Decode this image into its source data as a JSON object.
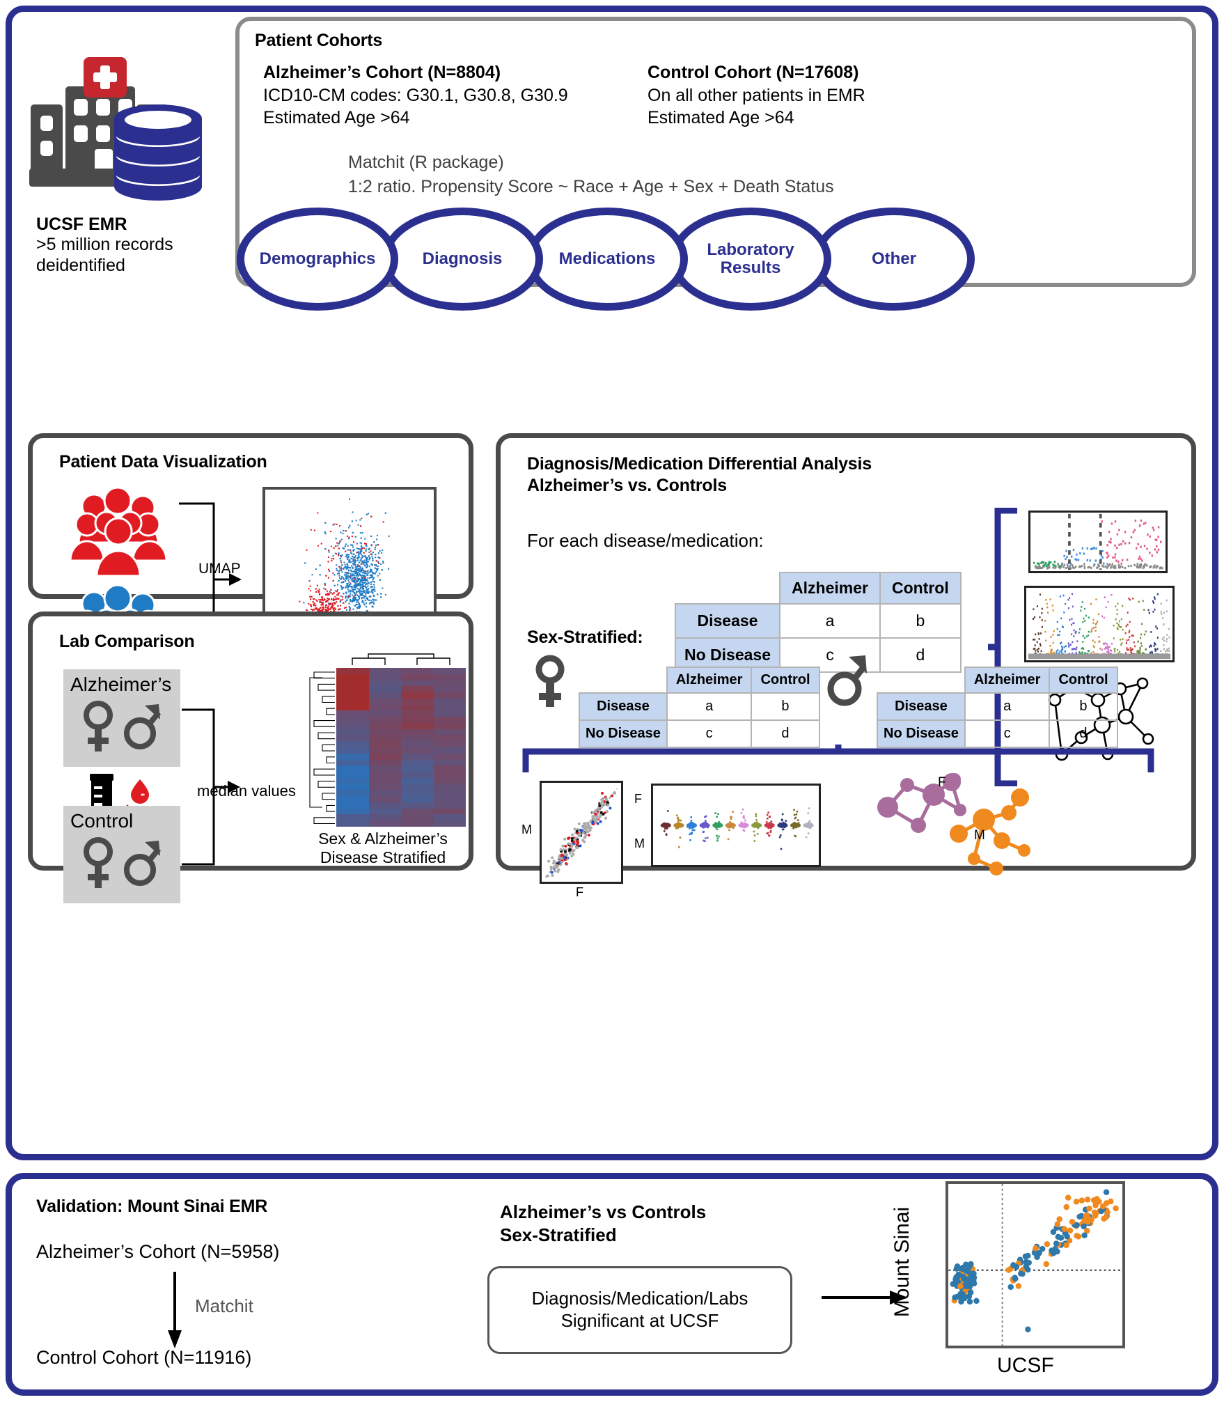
{
  "emr_source": {
    "icon": "hospital-database-icon",
    "title": "UCSF EMR",
    "line1": ">5 million records",
    "line2": "deidentified"
  },
  "cohorts_panel": {
    "title": "Patient Cohorts",
    "alzheimers": {
      "heading": "Alzheimer’s Cohort (N=8804)",
      "line1": "ICD10-CM codes: G30.1, G30.8, G30.9",
      "line2": "Estimated Age >64",
      "n": 8804
    },
    "control": {
      "heading": "Control Cohort (N=17608)",
      "line1": "On all other patients in EMR",
      "line2": "Estimated Age >64",
      "n": 17608
    },
    "matching": {
      "line1": "Matchit (R package)",
      "line2": "1:2 ratio. Propensity Score ~ Race + Age + Sex + Death Status"
    },
    "data_domains": [
      "Demographics",
      "Diagnosis",
      "Medications",
      "Laboratory Results",
      "Other"
    ]
  },
  "patient_data_visualization": {
    "title": "Patient Data Visualization",
    "group_alzheimers_icon": "people-group-icon",
    "group_control_icon": "people-group-icon",
    "arrow_label": "UMAP",
    "plot_name": "umap-scatter"
  },
  "lab_comparison": {
    "title": "Lab Comparison",
    "group_alzheimers": "Alzheimer’s",
    "group_control": "Control",
    "female_icon": "female-sex-icon",
    "male_icon": "male-sex-icon",
    "specimen_icon": "blood-tube-icon",
    "arrow_label": "median values",
    "heatmap_caption_line1": "Sex & Alzheimer’s",
    "heatmap_caption_line2": "Disease Stratified"
  },
  "differential_analysis": {
    "title_line1": "Diagnosis/Medication Differential Analysis",
    "title_line2": "Alzheimer’s vs. Controls",
    "for_each": "For each disease/medication:",
    "table": {
      "col_headers": [
        "Alzheimer",
        "Control"
      ],
      "rows": [
        {
          "label": "Disease",
          "cells": [
            "a",
            "b"
          ]
        },
        {
          "label": "No Disease",
          "cells": [
            "c",
            "d"
          ]
        }
      ]
    },
    "outputs": [
      "volcano-plot",
      "manhattan-plot",
      "network-graph"
    ],
    "sex_stratified": {
      "title": "Sex-Stratified:",
      "female_table": {
        "icon": "female-sex-icon",
        "col_headers": [
          "Alzheimer",
          "Control"
        ],
        "rows": [
          {
            "label": "Disease",
            "cells": [
              "a",
              "b"
            ]
          },
          {
            "label": "No Disease",
            "cells": [
              "c",
              "d"
            ]
          }
        ]
      },
      "male_table": {
        "icon": "male-sex-icon",
        "col_headers": [
          "Alzheimer",
          "Control"
        ],
        "rows": [
          {
            "label": "Disease",
            "cells": [
              "a",
              "b"
            ]
          },
          {
            "label": "No Disease",
            "cells": [
              "c",
              "d"
            ]
          }
        ]
      },
      "scatter_axis_y": "M",
      "scatter_axis_x": "F",
      "strip_axis_top": "F",
      "strip_axis_bottom": "M",
      "network_label_female": "F",
      "network_label_male": "M"
    }
  },
  "validation": {
    "title": "Validation: Mount Sinai EMR",
    "alzheimers_cohort": "Alzheimer’s Cohort (N=5958)",
    "alzheimers_n": 5958,
    "arrow_label": "Matchit",
    "control_cohort": "Control Cohort (N=11916)",
    "control_n": 11916,
    "mid_title_line1": "Alzheimer’s vs Controls",
    "mid_title_line2": "Sex-Stratified",
    "mid_box_line1": "Diagnosis/Medication/Labs",
    "mid_box_line2": "Significant at UCSF",
    "scatter_ylabel": "Mount Sinai",
    "scatter_xlabel": "UCSF"
  },
  "colors": {
    "navy": "#2b2f8f",
    "alzheimers_red": "#e01b22",
    "control_blue": "#1f7bc4",
    "table_header_blue": "#c5d7f0",
    "panel_grey": "#8b8b8b",
    "panel_dark": "#4a4a4a",
    "cross_red": "#c6272e",
    "scatter_orange": "#f08a1e",
    "scatter_blue": "#2e78aa",
    "network_purple": "#a86d9c",
    "heatmap_warm": "#a32d2d",
    "heatmap_cool": "#2f6fb5"
  }
}
